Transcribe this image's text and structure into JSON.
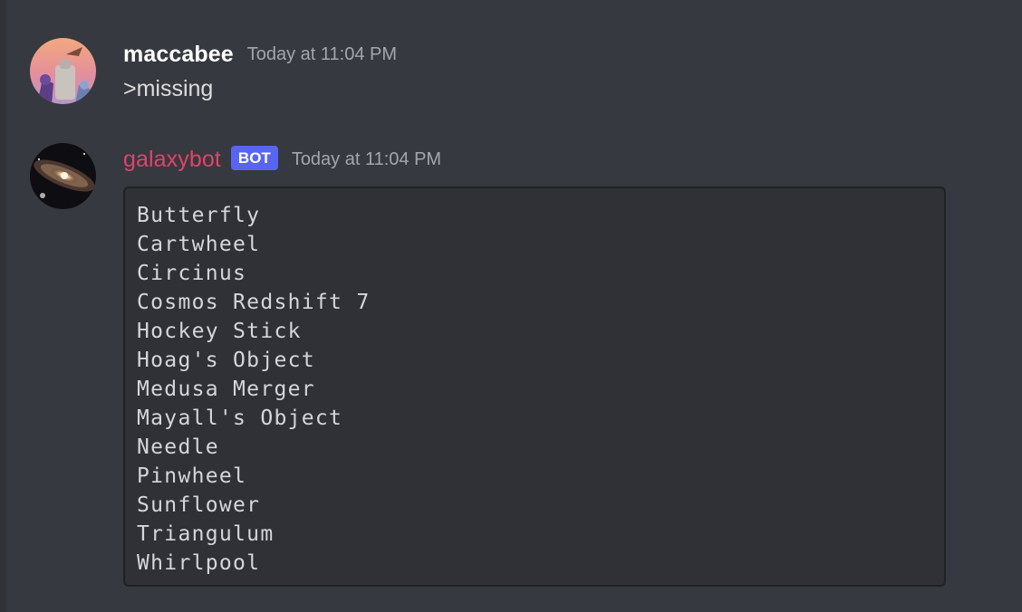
{
  "messages": [
    {
      "username": "maccabee",
      "timestamp": "Today at 11:04 PM",
      "text": ">missing",
      "is_bot": false
    },
    {
      "username": "galaxybot",
      "bot_tag": "BOT",
      "timestamp": "Today at 11:04 PM",
      "is_bot": true,
      "code_lines": [
        "Butterfly",
        "Cartwheel",
        "Circinus",
        "Cosmos Redshift 7",
        "Hockey Stick",
        "Hoag's Object",
        "Medusa Merger",
        "Mayall's Object",
        "Needle",
        "Pinwheel",
        "Sunflower",
        "Triangulum",
        "Whirlpool"
      ]
    }
  ],
  "colors": {
    "background": "#36393f",
    "codeblock_background": "#2f3136",
    "bot_username": "#e0436b",
    "bot_tag": "#5865f2",
    "timestamp": "#a3a6aa"
  }
}
